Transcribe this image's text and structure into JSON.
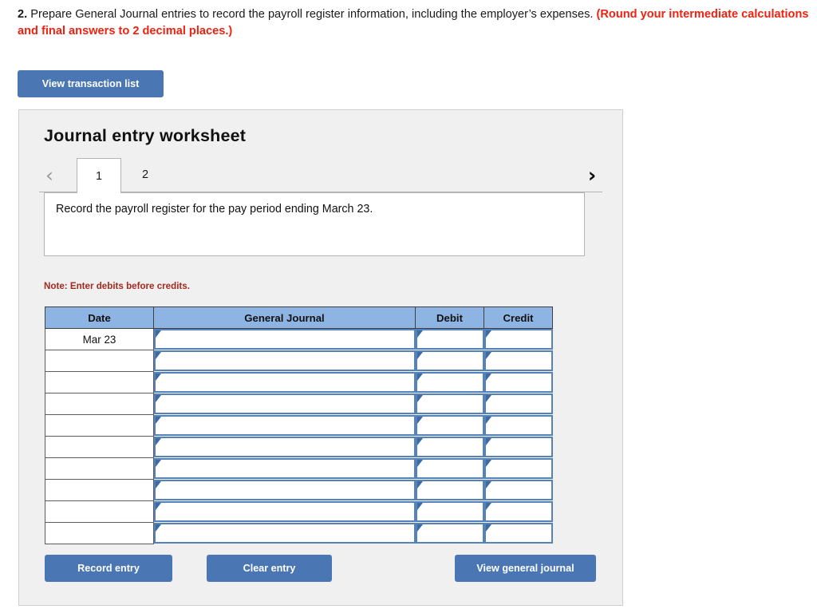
{
  "question": {
    "number": "2.",
    "text_black": "Prepare General Journal entries to record the payroll register information, including the employer’s expenses.",
    "text_red": "(Round your intermediate calculations and final answers to 2 decimal places.)"
  },
  "toolbar": {
    "view_transaction_list_label": "View transaction list"
  },
  "panel": {
    "title": "Journal entry worksheet",
    "tabs": {
      "prev_icon": "chevron-left-icon",
      "prev_glyph": "‹",
      "next_icon": "chevron-right-icon",
      "next_glyph": "›",
      "items": [
        {
          "label": "1",
          "active": true
        },
        {
          "label": "2",
          "active": false
        }
      ]
    },
    "instruction": "Record the payroll register for the pay period ending March 23.",
    "note": "Note: Enter debits before credits."
  },
  "table": {
    "columns": [
      "Date",
      "General Journal",
      "Debit",
      "Credit"
    ],
    "rows": [
      {
        "date": "Mar 23",
        "general_journal": "",
        "debit": "",
        "credit": ""
      },
      {
        "date": "",
        "general_journal": "",
        "debit": "",
        "credit": ""
      },
      {
        "date": "",
        "general_journal": "",
        "debit": "",
        "credit": ""
      },
      {
        "date": "",
        "general_journal": "",
        "debit": "",
        "credit": ""
      },
      {
        "date": "",
        "general_journal": "",
        "debit": "",
        "credit": ""
      },
      {
        "date": "",
        "general_journal": "",
        "debit": "",
        "credit": ""
      },
      {
        "date": "",
        "general_journal": "",
        "debit": "",
        "credit": ""
      },
      {
        "date": "",
        "general_journal": "",
        "debit": "",
        "credit": ""
      },
      {
        "date": "",
        "general_journal": "",
        "debit": "",
        "credit": ""
      },
      {
        "date": "",
        "general_journal": "",
        "debit": "",
        "credit": ""
      }
    ]
  },
  "actions": {
    "record_entry_label": "Record entry",
    "clear_entry_label": "Clear entry",
    "view_general_journal_label": "View general journal"
  },
  "colors": {
    "button_blue": "#4a77b4",
    "table_header_blue": "#8eb4e3",
    "field_border_blue": "#5582b8",
    "marker_blue": "#3d6aa3",
    "prompt_red": "#ee2211",
    "note_red": "#a5291f",
    "panel_gray": "#f0f0f0"
  }
}
